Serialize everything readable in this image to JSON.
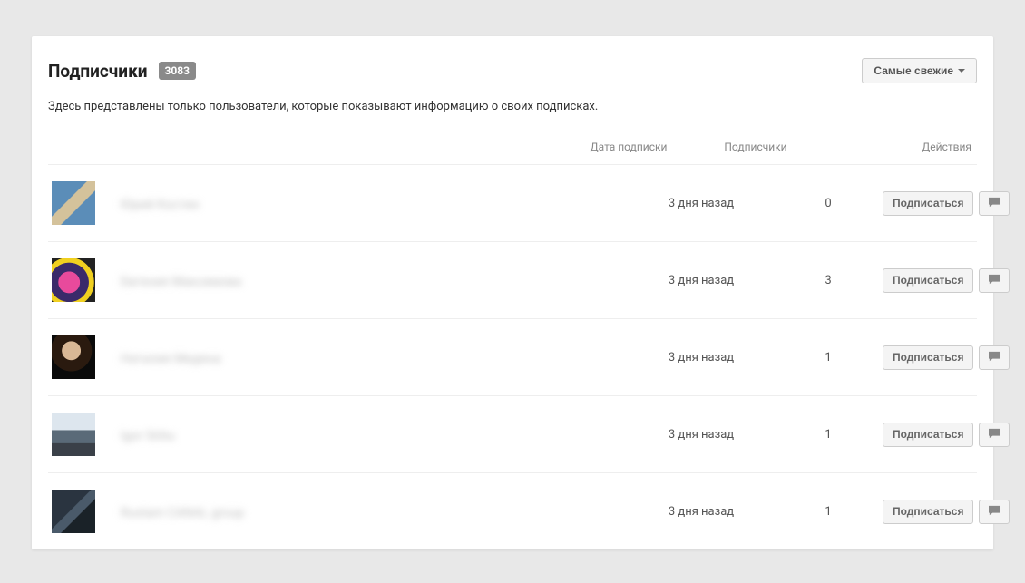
{
  "header": {
    "title": "Подписчики",
    "count": "3083",
    "sort_label": "Самые свежие"
  },
  "description": "Здесь представлены только пользователи, которые показывают информацию о своих подписках.",
  "columns": {
    "date": "Дата подписки",
    "subs": "Подписчики",
    "actions": "Действия"
  },
  "actions": {
    "subscribe": "Подписаться"
  },
  "rows": [
    {
      "name": "Юрий Костин",
      "date": "3 дня назад",
      "subs": "0"
    },
    {
      "name": "Евгения Максимова",
      "date": "3 дня назад",
      "subs": "3"
    },
    {
      "name": "Наталия Медяна",
      "date": "3 дня назад",
      "subs": "1"
    },
    {
      "name": "Igor Sirbu",
      "date": "3 дня назад",
      "subs": "1"
    },
    {
      "name": "Rustam CANAL group",
      "date": "3 дня назад",
      "subs": "1"
    }
  ]
}
